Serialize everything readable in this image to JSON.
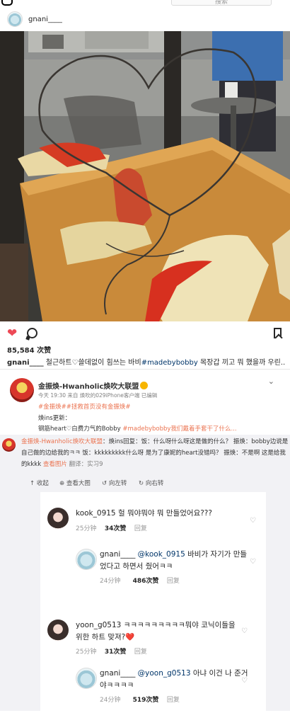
{
  "instagram": {
    "search_placeholder": "搜索",
    "username": "gnani____",
    "likes": "85,584 次赞",
    "caption_user": "gnani____",
    "caption_text": " 철근하트♡쓸데없이 힘쓰는 바비",
    "caption_tag": "#madebybobby",
    "caption_rest": " 목장갑 끼고 뭐 했을까 우린.."
  },
  "weibo": {
    "name": "金振焕-Hwanholic焕吹大联盟",
    "meta": "今天 19:30 来自 焕吹的029iPhone客户端 已编辑",
    "tags": "#金振焕##拯救首页没有金振焕#",
    "line1": "焕ins更新：",
    "line2_text": "钢筋heart♡白费力气的Bobby ",
    "line2_tag": "#madebybobby",
    "line2_rest": "我们戴着手套干了什么...",
    "line2_link": "#",
    "repost_name": "金振焕-Hwanholic焕吹大联盟",
    "repost_text": "：焕ins回复：饭：什么呀什么呀这是做的什么？ 振焕：bobby边说是自己做的边给我的ㅋㅋ 饭：kkkkkkkkk什么呀 是为了康妮的heart没错吗？ 振焕：不是啊 这是给我的kkkk ",
    "repost_link": "查看图片",
    "repost_trans": " 翻译：实习9",
    "toolbar": {
      "collect": "收起",
      "view_large": "查看大图",
      "rotate_left": "向左转",
      "rotate_right": "向右转"
    }
  },
  "comments": [
    {
      "user": "kook_0915",
      "text": "헐 뭐야뭐야 뭐 만들었어요???",
      "time": "25分钟",
      "likes": "34次赞",
      "reply": "回复"
    },
    {
      "user": "gnani____",
      "mention": "@kook_0915",
      "text": " 바비가 자기가 만들었다고 하면서 줬어ㅋㅋ",
      "time": "24分钟",
      "likes": "486次赞",
      "reply": "回复"
    },
    {
      "user": "yoon_g0513",
      "text": "ㅋㅋㅋㅋㅋㅋㅋㅋㅋ뭐야 코닉이들을 위한 하트 맞져?❤️",
      "time": "25分钟",
      "likes": "31次赞",
      "reply": "回复"
    },
    {
      "user": "gnani____",
      "mention": "@yoon_g0513",
      "text": " 아냐 이건 나 준거야ㅋㅋㅋㅋ",
      "time": "24分钟",
      "likes": "519次赞",
      "reply": "回复"
    }
  ],
  "icons": [
    "instagram-logo",
    "search-icon",
    "heart-icon",
    "comment-icon",
    "bookmark-icon",
    "chevron-down-icon",
    "collect-icon",
    "zoom-icon",
    "rotate-left-icon",
    "rotate-right-icon"
  ],
  "colors": {
    "like_red": "#ed4956",
    "weibo_orange": "#eb7350",
    "link_blue": "#003569"
  }
}
